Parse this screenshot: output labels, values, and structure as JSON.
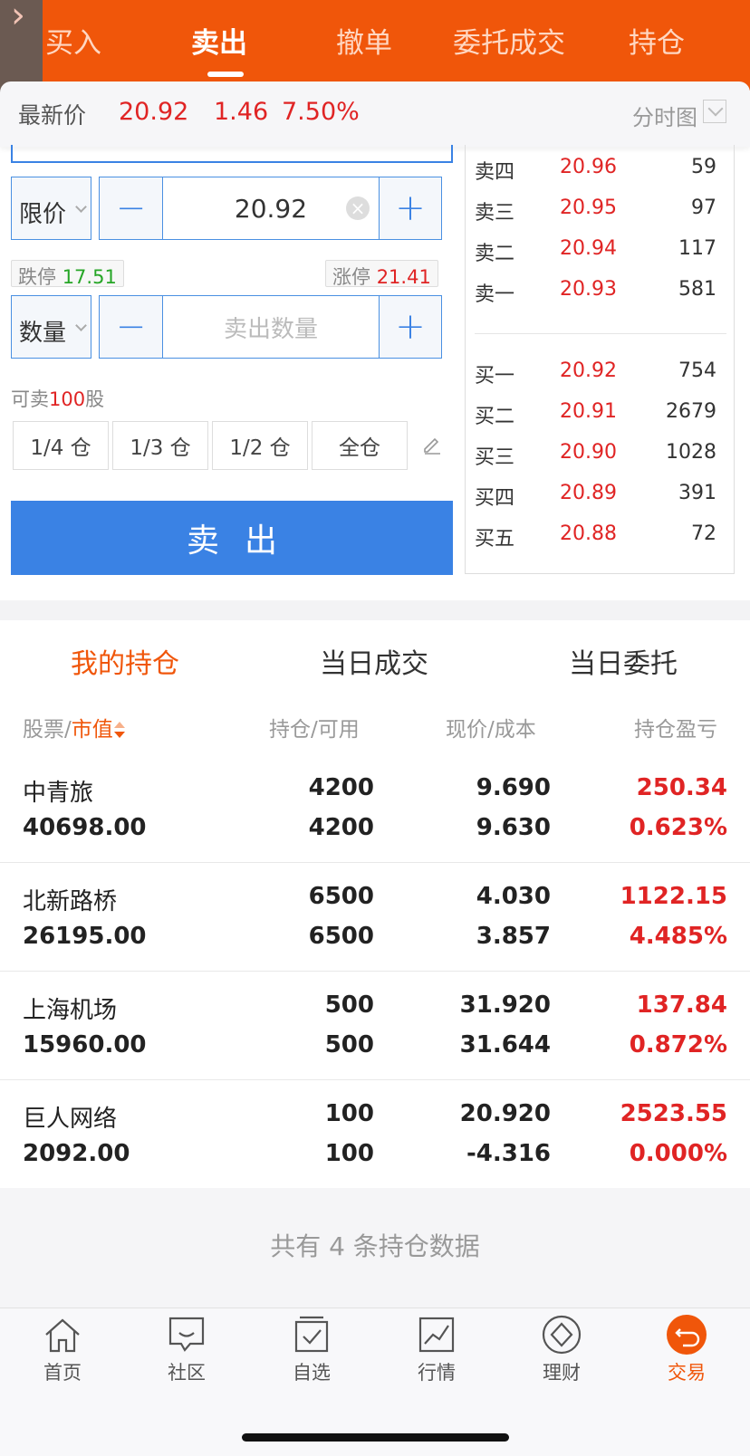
{
  "tabs": [
    "买入",
    "卖出",
    "撤单",
    "委托成交",
    "持仓"
  ],
  "price_bar": {
    "label": "最新价",
    "price": "20.92",
    "change": "1.46",
    "change_pct": "7.50%",
    "chart_label": "分时图"
  },
  "order": {
    "price_type": "限价",
    "price_value": "20.92",
    "limit_down_label": "跌停",
    "limit_down": "17.51",
    "limit_up_label": "涨停",
    "limit_up": "21.41",
    "qty_type": "数量",
    "qty_placeholder": "卖出数量",
    "can_sell_prefix": "可卖",
    "can_sell_qty": "100",
    "can_sell_unit": "股",
    "position_buttons": [
      "1/4 仓",
      "1/3 仓",
      "1/2 仓",
      "全仓"
    ],
    "sell_button": "卖出"
  },
  "order_book": {
    "asks": [
      {
        "name": "卖四",
        "price": "20.96",
        "qty": "59"
      },
      {
        "name": "卖三",
        "price": "20.95",
        "qty": "97"
      },
      {
        "name": "卖二",
        "price": "20.94",
        "qty": "117"
      },
      {
        "name": "卖一",
        "price": "20.93",
        "qty": "581"
      }
    ],
    "bids": [
      {
        "name": "买一",
        "price": "20.92",
        "qty": "754"
      },
      {
        "name": "买二",
        "price": "20.91",
        "qty": "2679"
      },
      {
        "name": "买三",
        "price": "20.90",
        "qty": "1028"
      },
      {
        "name": "买四",
        "price": "20.89",
        "qty": "391"
      },
      {
        "name": "买五",
        "price": "20.88",
        "qty": "72"
      }
    ]
  },
  "holdings": {
    "tabs": [
      "我的持仓",
      "当日成交",
      "当日委托"
    ],
    "headers": {
      "stock": "股票",
      "slash1": "/",
      "market_value": "市值",
      "position": "持仓/可用",
      "price": "现价/成本",
      "pnl": "持仓盈亏"
    },
    "rows": [
      {
        "name": "中青旅",
        "market_value": "40698.00",
        "hold": "4200",
        "avail": "4200",
        "price": "9.690",
        "cost": "9.630",
        "pnl": "250.34",
        "pnl_pct": "0.623%"
      },
      {
        "name": "北新路桥",
        "market_value": "26195.00",
        "hold": "6500",
        "avail": "6500",
        "price": "4.030",
        "cost": "3.857",
        "pnl": "1122.15",
        "pnl_pct": "4.485%"
      },
      {
        "name": "上海机场",
        "market_value": "15960.00",
        "hold": "500",
        "avail": "500",
        "price": "31.920",
        "cost": "31.644",
        "pnl": "137.84",
        "pnl_pct": "0.872%"
      },
      {
        "name": "巨人网络",
        "market_value": "2092.00",
        "hold": "100",
        "avail": "100",
        "price": "20.920",
        "cost": "-4.316",
        "pnl": "2523.55",
        "pnl_pct": "0.000%"
      }
    ],
    "footer": "共有 4 条持仓数据"
  },
  "nav": [
    "首页",
    "社区",
    "自选",
    "行情",
    "理财",
    "交易"
  ],
  "colors": {
    "brand": "#f0560a",
    "blue": "#3a82e4",
    "red": "#e02424",
    "green": "#26a626"
  }
}
